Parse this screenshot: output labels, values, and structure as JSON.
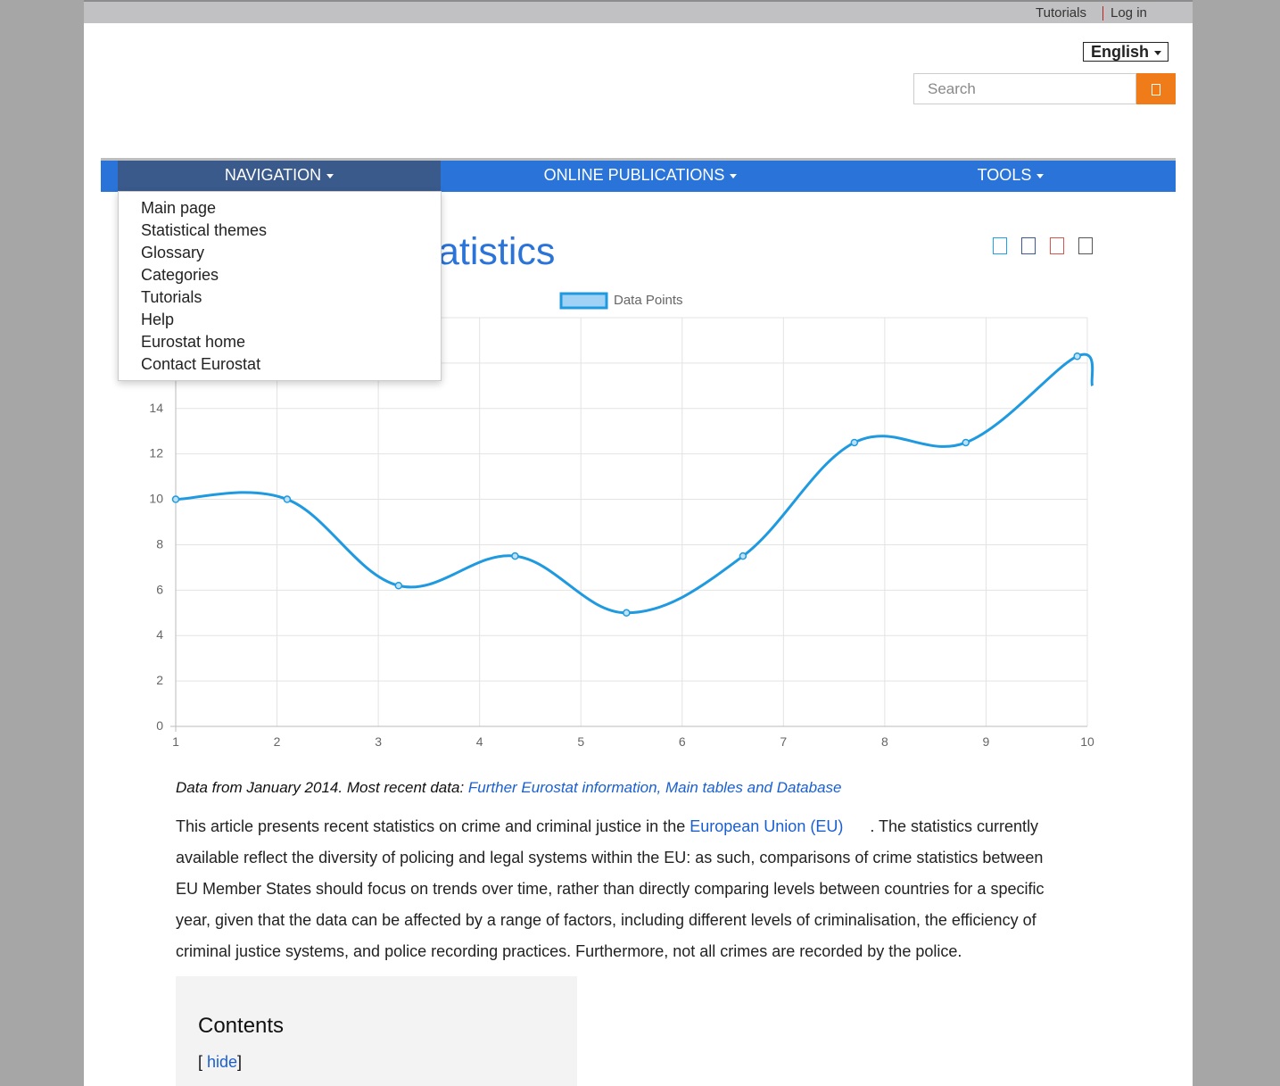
{
  "topbar": {
    "tutorials": "Tutorials",
    "login": "Log in"
  },
  "language": {
    "selected": "English"
  },
  "search": {
    "placeholder": "Search",
    "button_icon": "search-icon"
  },
  "nav": {
    "navigation": "NAVIGATION",
    "publications": "ONLINE PUBLICATIONS",
    "tools": "TOOLS",
    "dropdown": [
      "Main page",
      "Statistical themes",
      "Glossary",
      "Categories",
      "Tutorials",
      "Help",
      "Eurostat home",
      "Contact Eurostat"
    ]
  },
  "page": {
    "title_visible": "atistics"
  },
  "share_icons": [
    {
      "name": "twitter-icon",
      "color": "#1da1f2"
    },
    {
      "name": "facebook-icon",
      "color": "#3b5998"
    },
    {
      "name": "linkedin-icon",
      "color": "#d9534f"
    },
    {
      "name": "email-icon",
      "color": "#555555"
    }
  ],
  "chart_data": {
    "type": "line",
    "x": [
      1,
      2,
      3,
      4,
      5,
      6,
      7,
      8,
      9,
      10
    ],
    "series": [
      {
        "name": "Data Points",
        "color": "#1f9ae0",
        "points": [
          [
            1,
            10
          ],
          [
            2.1,
            10
          ],
          [
            3.2,
            6.2
          ],
          [
            4.35,
            7.5
          ],
          [
            5.45,
            5
          ],
          [
            6.6,
            7.5
          ],
          [
            7.7,
            12.5
          ],
          [
            8.8,
            12.5
          ],
          [
            9.9,
            16.3
          ]
        ],
        "continues_beyond": [
          10.05,
          15
        ]
      }
    ],
    "yticks": [
      0,
      2,
      4,
      6,
      8,
      10,
      12,
      14
    ],
    "ylim": [
      0,
      18
    ],
    "xlim": [
      1,
      10
    ],
    "grid": true,
    "legend": "top"
  },
  "caption": {
    "text": "Data from January 2014. Most recent data: ",
    "link": "Further Eurostat information, Main tables and Database"
  },
  "article": {
    "before": "This article presents recent statistics on crime and criminal justice in the ",
    "link": "European Union (EU)",
    "after": "      . The statistics currently available reflect the diversity of policing and legal systems within the EU: as such, comparisons of crime statistics between EU Member States should focus on trends over time, rather than directly comparing levels between countries for a specific year, given that the data can be affected by a range of factors, including different levels of criminalisation, the efficiency of criminal justice systems, and police recording practices. Furthermore, not all crimes are recorded by the police."
  },
  "toc": {
    "title": "Contents",
    "hide": "hide"
  }
}
